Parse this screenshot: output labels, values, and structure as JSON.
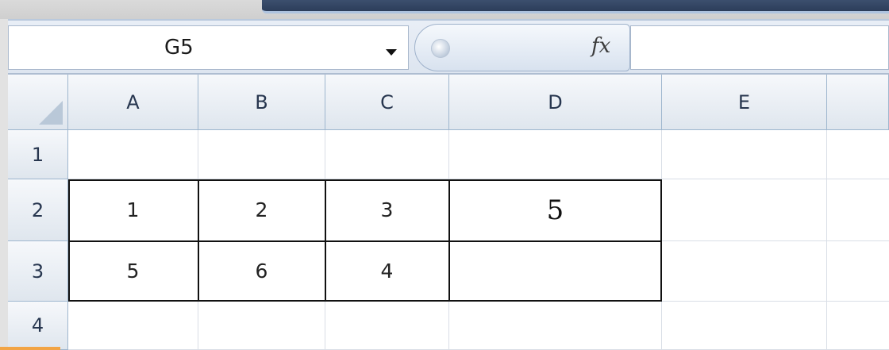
{
  "formula_bar": {
    "name_box_value": "G5",
    "fx_label": "fx",
    "formula_value": ""
  },
  "sheet": {
    "columns": [
      "A",
      "B",
      "C",
      "D",
      "E"
    ],
    "rows": [
      "1",
      "2",
      "3",
      "4"
    ],
    "cells": {
      "A1": "",
      "B1": "",
      "C1": "",
      "D1": "",
      "E1": "",
      "A2": "1",
      "B2": "2",
      "C2": "3",
      "D2": "5",
      "E2": "",
      "A3": "5",
      "B3": "6",
      "C3": "4",
      "D3": "",
      "E3": "",
      "A4": "",
      "B4": "",
      "C4": "",
      "D4": "",
      "E4": ""
    }
  },
  "colors": {
    "header_text": "#27364f",
    "grid_line": "#d9dee6",
    "table_border": "#111111"
  }
}
